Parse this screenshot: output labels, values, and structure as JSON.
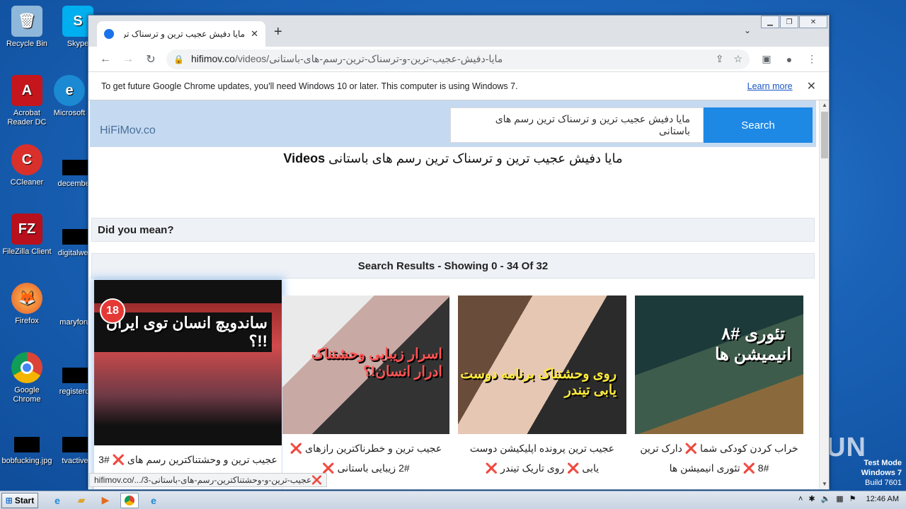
{
  "desktop_icons": [
    {
      "label": "Recycle Bin",
      "icon": "recycle-bin-icon"
    },
    {
      "label": "Skype",
      "icon": "skype-icon"
    },
    {
      "label": "Acrobat Reader DC",
      "icon": "acrobat-icon"
    },
    {
      "label": "Microsoft",
      "icon": "edge-icon"
    },
    {
      "label": "CCleaner",
      "icon": "ccleaner-icon"
    },
    {
      "label": "december",
      "icon": "file-icon"
    },
    {
      "label": "FileZilla Client",
      "icon": "filezilla-icon"
    },
    {
      "label": "digitalwes",
      "icon": "file-icon"
    },
    {
      "label": "Firefox",
      "icon": "firefox-icon"
    },
    {
      "label": "maryforu",
      "icon": "file-icon"
    },
    {
      "label": "Google Chrome",
      "icon": "chrome-icon"
    },
    {
      "label": "registercl",
      "icon": "file-icon"
    },
    {
      "label": "bobfucking.jpg",
      "icon": "file-icon"
    },
    {
      "label": "tvactive",
      "icon": "file-icon"
    }
  ],
  "browser": {
    "tab_title": "مایا دفیش عجیب ترین و ترسناک ترین",
    "url_host": "hifimov.co",
    "url_path": "/videos/مایا-دفیش-عجیب-ترین-و-ترسناک-ترین-رسم-های-باستانی",
    "infobar_message": "To get future Google Chrome updates, you'll need Windows 10 or later. This computer is using Windows 7.",
    "infobar_link": "Learn more",
    "status_url": "hifimov.co/.../3-عجیب-ترین-و-وحشتناکترین-رسم-های-باستانی❌"
  },
  "site": {
    "logo": "HiFiMov.co",
    "search_value": "مایا دفیش عجیب ترین و ترسناک ترین رسم های باستانی",
    "search_button": "Search",
    "title_bold": "Videos",
    "title_query": "مایا دفیش عجیب ترین و ترسناک ترین رسم های باستانی",
    "did_you_mean": "Did you mean?",
    "results_summary": "Search Results - Showing 0 - 34 Of 32",
    "videos": [
      {
        "title": "عجیب ترین و وحشتناکترین رسم های ❌ #3",
        "overlay": "ساندویچ انسان توی ایران !!؟",
        "badge": "18"
      },
      {
        "title": "عجیب ترین و خطرناکترین رازهای ❌ #2 زیبایی باستانی ❌",
        "overlay": "اسرار زیبایی وحشتناک ادرار انسان!؟"
      },
      {
        "title": "عجیب ترین پرونده اپلیکیشن دوست یابی ❌ روی تاریک تیندر ❌",
        "overlay": "روی وحشتناک برنامه دوست یابی تیندر"
      },
      {
        "title": "خراب کردن کودکی شما ❌ دارک ترین #8 ❌ تئوری انیمیشن ها",
        "overlay": "تئوری #۸ انیمیشن ها"
      }
    ]
  },
  "watermark": "ANY.RUN",
  "os": {
    "line1": "Test Mode",
    "line2": "Windows 7",
    "line3": "Build 7601"
  },
  "taskbar": {
    "start": "Start",
    "clock": "12:46 AM"
  }
}
